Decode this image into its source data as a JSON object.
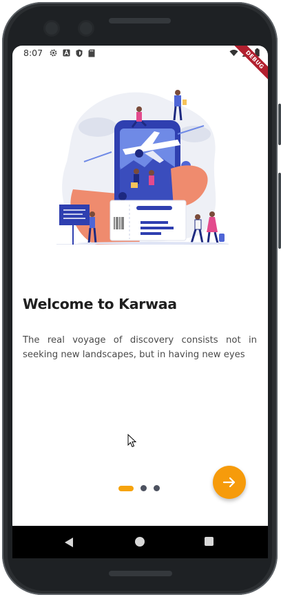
{
  "status_bar": {
    "time": "8:07",
    "left_icons": [
      "gear-icon",
      "font-a-icon",
      "shield-icon",
      "sd-card-icon"
    ],
    "right_icons": [
      "wifi-icon",
      "signal-icon",
      "battery-icon"
    ]
  },
  "debug_banner": {
    "label": "DEBUG"
  },
  "onboarding": {
    "title": "Welcome to Karwaa",
    "description": "The real voyage of discovery consists not in seeking new landscapes, but in having new eyes",
    "page_indicator": {
      "total": 3,
      "active_index": 0
    },
    "next_button": {
      "icon": "arrow-right-icon"
    }
  },
  "colors": {
    "accent": "#f69b0b",
    "title": "#1f1f1f",
    "body_text": "#4a4a4a",
    "dot_inactive": "#4d5260",
    "illustration_blue": "#2f3fb0"
  },
  "system_nav": {
    "buttons": [
      "back-icon",
      "home-icon",
      "recents-icon"
    ]
  }
}
